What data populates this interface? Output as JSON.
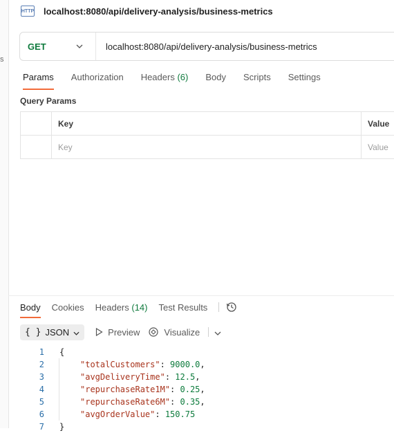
{
  "request": {
    "title": "localhost:8080/api/delivery-analysis/business-metrics",
    "method": "GET",
    "url": "localhost:8080/api/delivery-analysis/business-metrics"
  },
  "sidebar_edge_glyph": "s",
  "request_tabs": [
    {
      "label": "Params",
      "count": ""
    },
    {
      "label": "Authorization",
      "count": ""
    },
    {
      "label": "Headers",
      "count": "(6)"
    },
    {
      "label": "Body",
      "count": ""
    },
    {
      "label": "Scripts",
      "count": ""
    },
    {
      "label": "Settings",
      "count": ""
    }
  ],
  "query_params": {
    "label": "Query Params",
    "col_key": "Key",
    "col_value": "Value",
    "key_placeholder": "Key",
    "value_placeholder": "Value"
  },
  "response_tabs": [
    {
      "label": "Body",
      "count": ""
    },
    {
      "label": "Cookies",
      "count": ""
    },
    {
      "label": "Headers",
      "count": "(14)"
    },
    {
      "label": "Test Results",
      "count": ""
    }
  ],
  "view": {
    "format": "JSON",
    "preview": "Preview",
    "visualize": "Visualize"
  },
  "response_body": {
    "open": "{",
    "close": "}",
    "entries": [
      {
        "key": "\"totalCustomers\"",
        "value": "9000.0",
        "sep": ","
      },
      {
        "key": "\"avgDeliveryTime\"",
        "value": "12.5",
        "sep": ","
      },
      {
        "key": "\"repurchaseRate1M\"",
        "value": "0.25",
        "sep": ","
      },
      {
        "key": "\"repurchaseRate6M\"",
        "value": "0.35",
        "sep": ","
      },
      {
        "key": "\"avgOrderValue\"",
        "value": "150.75",
        "sep": ""
      }
    ],
    "line_numbers": [
      "1",
      "2",
      "3",
      "4",
      "5",
      "6",
      "7"
    ]
  }
}
